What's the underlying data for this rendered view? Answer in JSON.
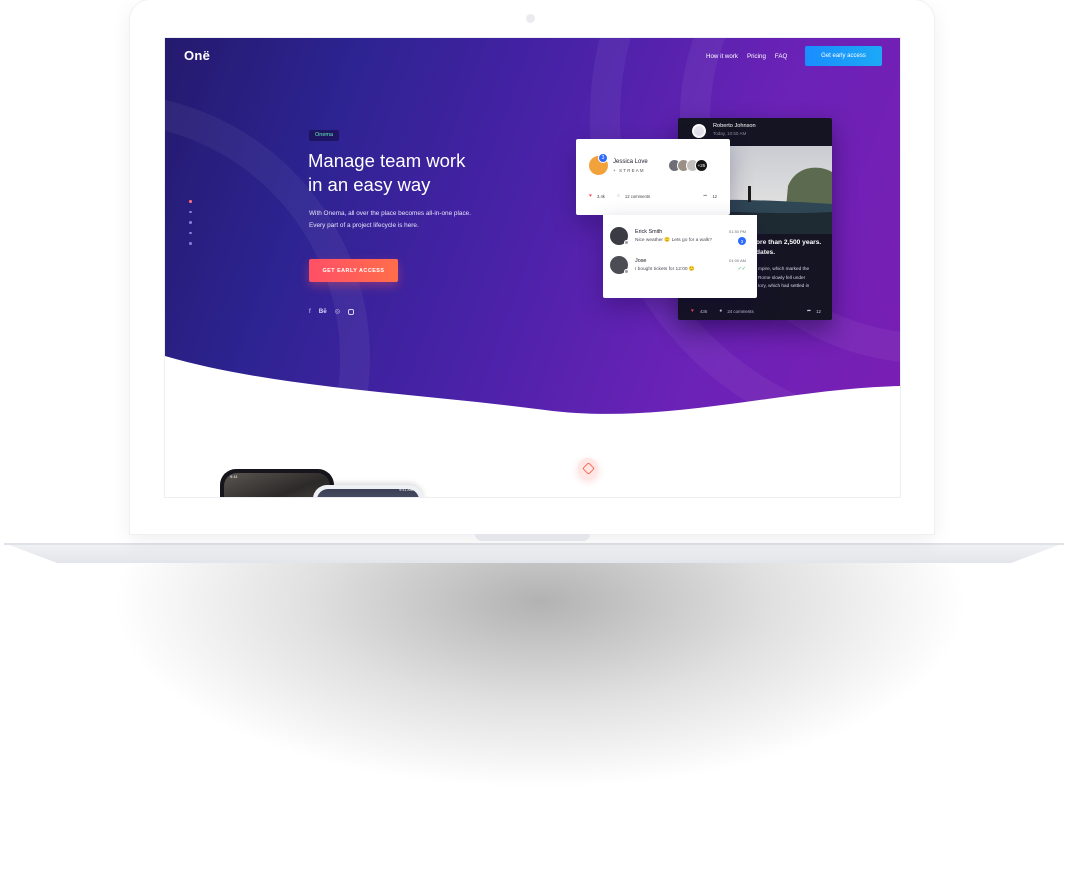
{
  "nav": {
    "logo": "Onë",
    "links": [
      "How it work",
      "Pricing",
      "FAQ"
    ],
    "cta": "Get early access"
  },
  "hero": {
    "tag": "Onema",
    "headline_line1": "Manage team work",
    "headline_line2": "in an easy way",
    "subtext_line1": "With Onema, all over the place becomes all-in-one place.",
    "subtext_line2": "Every part of a project lifecycle is here.",
    "cta": "GET EARLY ACCESS",
    "social": [
      "f",
      "Bē",
      "◎",
      "instagram"
    ],
    "slide_count": 5,
    "active_slide": 1
  },
  "post_card": {
    "author": "Roberto Johnson",
    "time": "Today, 10:50 AM",
    "headline_line1": "ore than 2,500 years.",
    "headline_line2": "dates.",
    "body_line1": "mpire, which marked the",
    "body_line2": "Rome slowly fell under",
    "body_line3": "tory, which had settled in",
    "likes": "436",
    "comments": "24 comments",
    "shares": "12"
  },
  "notification_card": {
    "badge": "3",
    "name": "Jessica Love",
    "subtitle": "+ STREAM",
    "more_count": "+25",
    "likes": "3.4k",
    "comments": "12 comments",
    "shares": "12"
  },
  "chat": [
    {
      "name": "Erick Smith",
      "text": "Nice weather 🙂 Lets go for a walk?",
      "time": "01:30 PM",
      "unread": "3"
    },
    {
      "name": "Jose",
      "text": "I bought tickets for 12:00 🙂",
      "time": "01:00 AM",
      "status": "✓✓"
    }
  ],
  "phones": {
    "phone1_time": "9:41",
    "phone2_time": "9:41 AM"
  },
  "colors": {
    "hero_start": "#241a6e",
    "hero_end": "#7a1eb4",
    "nav_cta": "#1a8dff",
    "hero_cta": "#ff4f66",
    "tag_text": "#5ff0b5"
  }
}
